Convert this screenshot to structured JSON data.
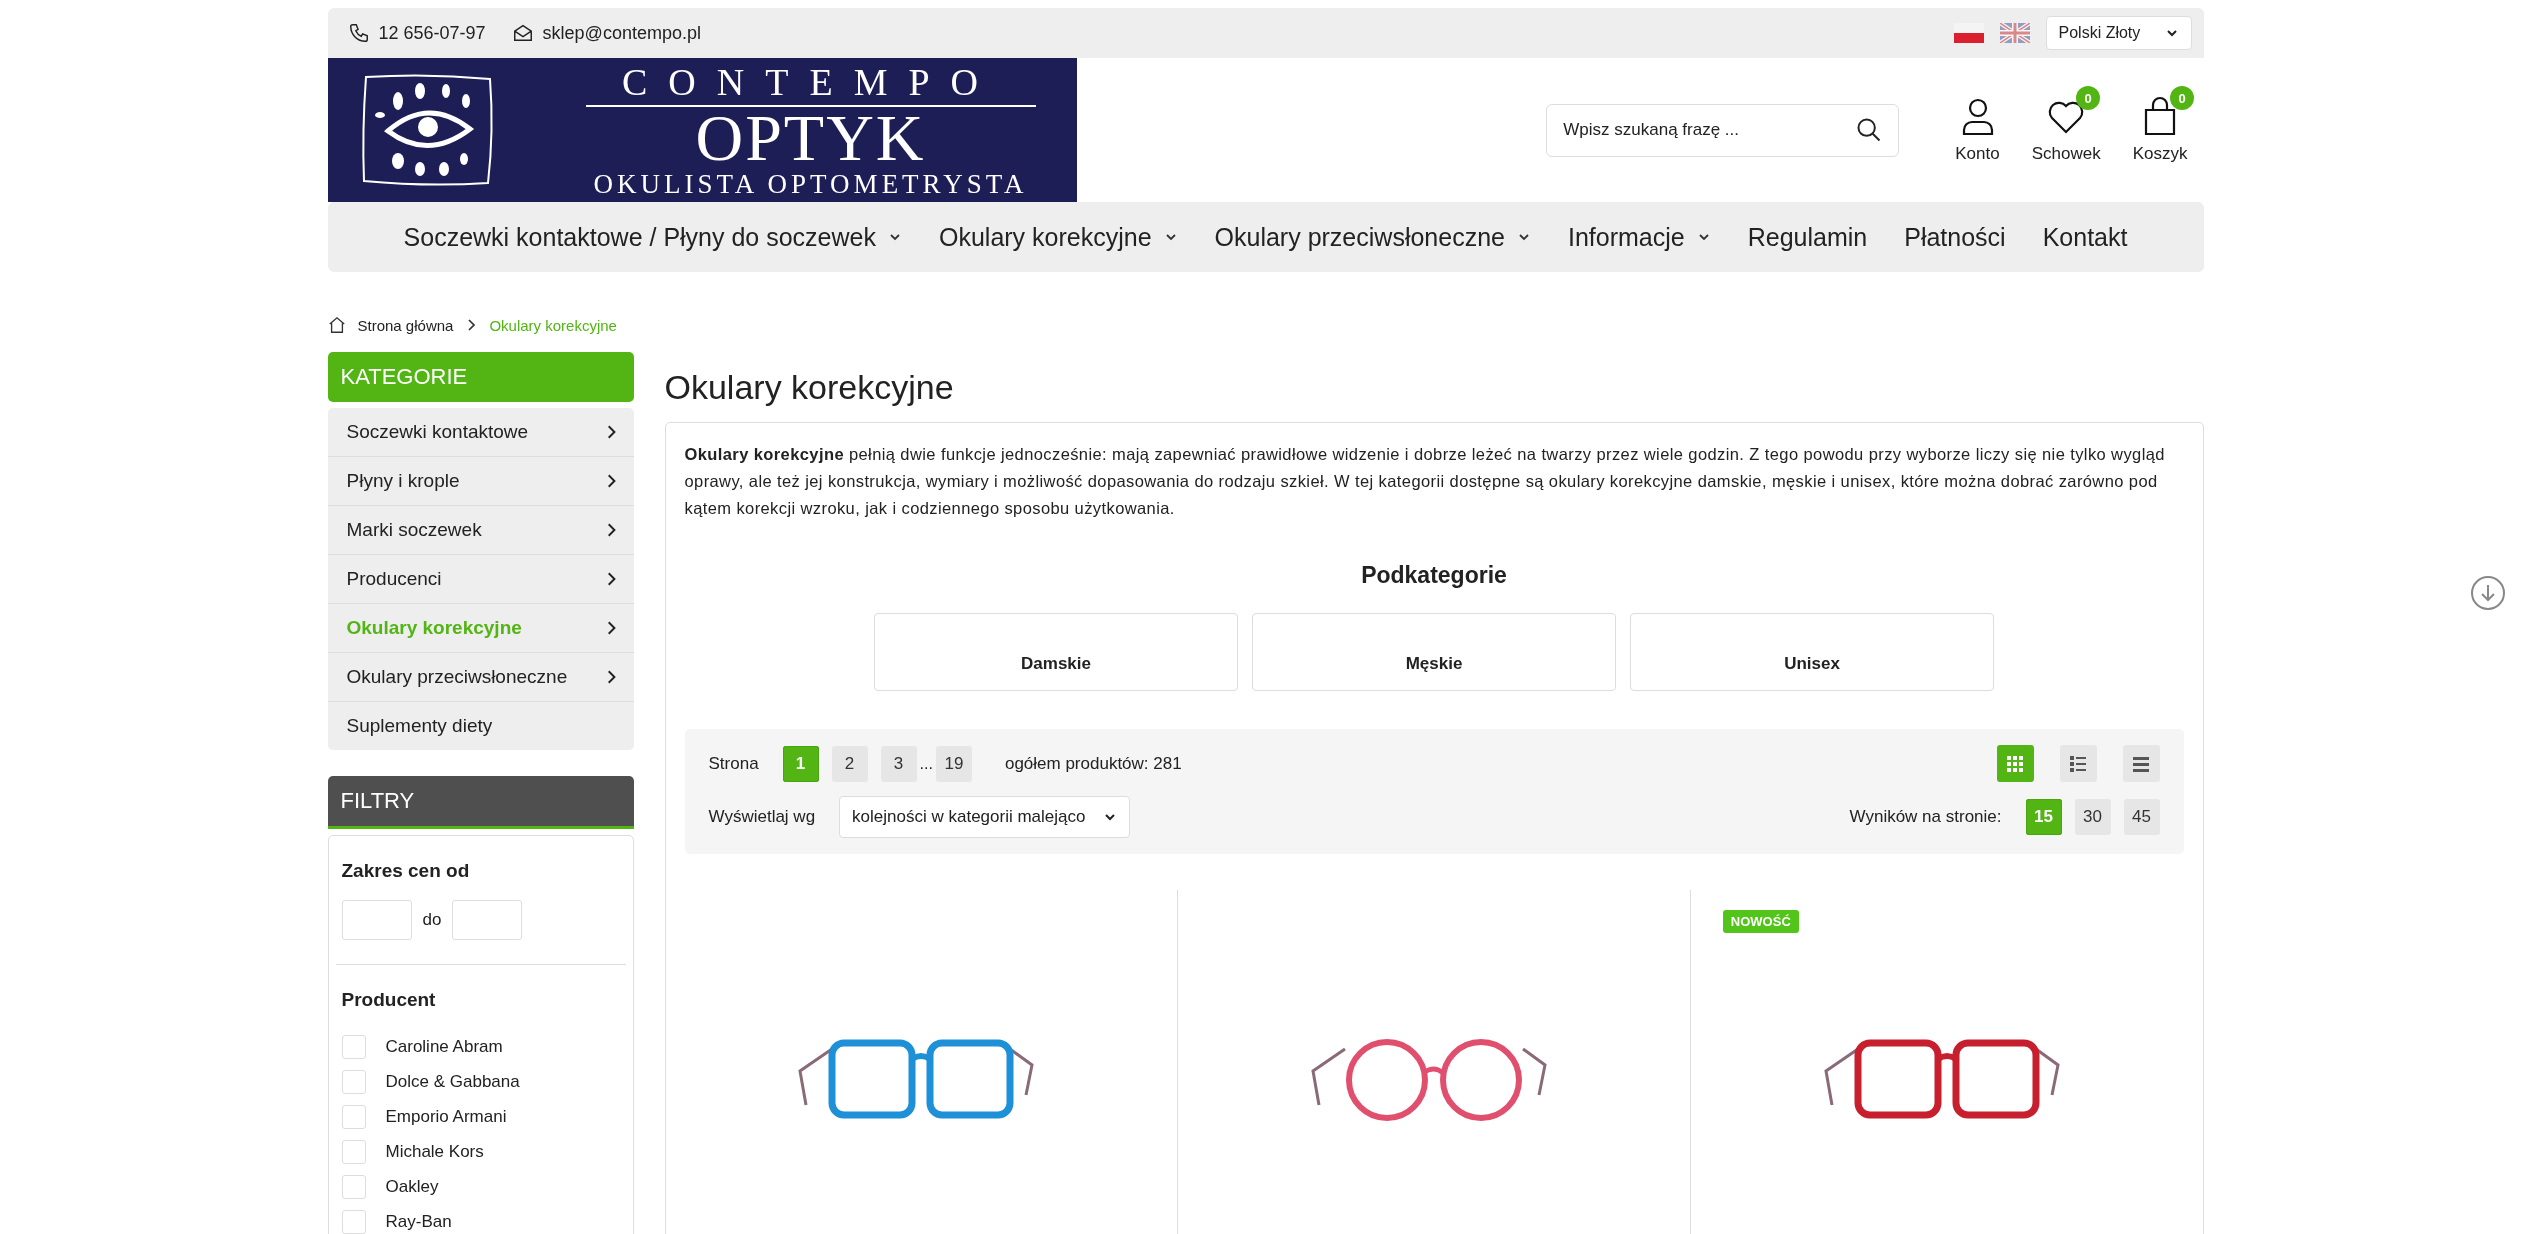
{
  "top_bar": {
    "phone": "12 656-07-97",
    "email": "sklep@contempo.pl",
    "currency": "Polski Złoty"
  },
  "logo": {
    "line_1": "CONTEMPO",
    "line_2": "OPTYK",
    "line_3": "OKULISTA OPTOMETRYSTA"
  },
  "search": {
    "placeholder": "Wpisz szukaną frazę ..."
  },
  "header_actions": [
    {
      "kind": "account",
      "label": "Konto"
    },
    {
      "kind": "wishlist",
      "label": "Schowek",
      "count": "0"
    },
    {
      "kind": "cart",
      "label": "Koszyk",
      "count": "0"
    }
  ],
  "nav": [
    {
      "label": "Soczewki kontaktowe / Płyny do soczewek",
      "dropdown": true
    },
    {
      "label": "Okulary korekcyjne",
      "dropdown": true
    },
    {
      "label": "Okulary przeciwsłoneczne",
      "dropdown": true
    },
    {
      "label": "Informacje",
      "dropdown": true
    },
    {
      "label": "Regulamin",
      "dropdown": false
    },
    {
      "label": "Płatności",
      "dropdown": false
    },
    {
      "label": "Kontakt",
      "dropdown": false
    }
  ],
  "breadcrumb": [
    {
      "kind": "home",
      "label": "Strona główna",
      "selected": false
    },
    {
      "kind": "page",
      "label": "Okulary korekcyjne",
      "selected": true
    }
  ],
  "sidebar": {
    "categories_title": "KATEGORIE",
    "categories": [
      {
        "label": "Soczewki kontaktowe",
        "selected": false,
        "has_children": true
      },
      {
        "label": "Płyny i krople",
        "selected": false,
        "has_children": true
      },
      {
        "label": "Marki soczewek",
        "selected": false,
        "has_children": true
      },
      {
        "label": "Producenci",
        "selected": false,
        "has_children": true
      },
      {
        "label": "Okulary korekcyjne",
        "selected": true,
        "has_children": true
      },
      {
        "label": "Okulary przeciwsłoneczne",
        "selected": false,
        "has_children": true
      },
      {
        "label": "Suplementy diety",
        "selected": false,
        "has_children": false
      }
    ],
    "filters_title": "FILTRY",
    "price": {
      "title": "Zakres cen od",
      "separator": "do"
    },
    "producer": {
      "title": "Producent",
      "options": [
        {
          "label": "Caroline Abram",
          "checked": false
        },
        {
          "label": "Dolce & Gabbana",
          "checked": false
        },
        {
          "label": "Emporio Armani",
          "checked": false
        },
        {
          "label": "Michale Kors",
          "checked": false
        },
        {
          "label": "Oakley",
          "checked": false
        },
        {
          "label": "Ray-Ban",
          "checked": false
        }
      ]
    }
  },
  "main": {
    "title": "Okulary korekcyjne",
    "description": "**Okulary korekcyjne** pełnią dwie funkcje jednocześnie: mają zapewniać prawidłowe widzenie i dobrze leżeć na twarzy przez wiele godzin. Z tego powodu przy wyborze liczy się nie tylko wygląd oprawy, ale też jej konstrukcja, wymiary i możliwość dopasowania do rodzaju szkieł. W tej kategorii dostępne są okulary korekcyjne damskie, męskie i unisex, które można dobrać zarówno pod kątem korekcji wzroku, jak i codziennego sposobu użytkowania.",
    "subcategories_title": "Podkategorie",
    "subcategories": [
      "Damskie",
      "Męskie",
      "Unisex"
    ],
    "toolbar": {
      "page_label": "Strona",
      "pages": [
        {
          "kind": "page",
          "label": "1",
          "selected": true
        },
        {
          "kind": "page",
          "label": "2",
          "selected": false
        },
        {
          "kind": "page",
          "label": "3",
          "selected": false
        },
        {
          "kind": "gap",
          "label": "..."
        },
        {
          "kind": "page",
          "label": "19",
          "selected": false
        }
      ],
      "total": "ogółem produktów: 281",
      "sort_label": "Wyświetlaj wg",
      "sort_value": "kolejności w kategorii malejąco",
      "views": [
        {
          "kind": "grid",
          "selected": true
        },
        {
          "kind": "list",
          "selected": false
        },
        {
          "kind": "rows",
          "selected": false
        }
      ],
      "per_page_label": "Wyników na stronie:",
      "per_page": [
        {
          "label": "15",
          "selected": true
        },
        {
          "label": "30",
          "selected": false
        },
        {
          "label": "45",
          "selected": false
        }
      ]
    },
    "products": [
      {
        "kind": "square",
        "color": "#1e90d8"
      },
      {
        "kind": "round",
        "color": "#e0506e"
      },
      {
        "kind": "square",
        "color": "#c81f2e",
        "badge": "NOWOŚĆ"
      }
    ]
  }
}
